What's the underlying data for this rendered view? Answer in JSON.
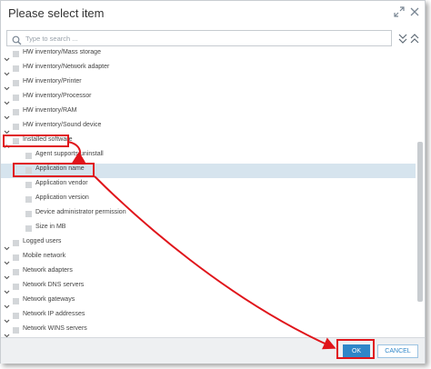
{
  "dialog": {
    "title": "Please select item",
    "expand_icon": "expand-diagonal-icon",
    "close_icon": "close-icon"
  },
  "search": {
    "placeholder": "Type to search ...",
    "value": ""
  },
  "tree": {
    "items": [
      {
        "label": "HW inventory/Mass storage",
        "expanded": false,
        "level": 0
      },
      {
        "label": "HW inventory/Network adapter",
        "expanded": false,
        "level": 0
      },
      {
        "label": "HW inventory/Printer",
        "expanded": false,
        "level": 0
      },
      {
        "label": "HW inventory/Processor",
        "expanded": false,
        "level": 0
      },
      {
        "label": "HW inventory/RAM",
        "expanded": false,
        "level": 0
      },
      {
        "label": "HW inventory/Sound device",
        "expanded": false,
        "level": 0
      },
      {
        "label": "Installed software",
        "expanded": true,
        "level": 0
      },
      {
        "label": "Agent supports uninstall",
        "level": 1
      },
      {
        "label": "Application name",
        "level": 1,
        "selected": true
      },
      {
        "label": "Application vendor",
        "level": 1
      },
      {
        "label": "Application version",
        "level": 1
      },
      {
        "label": "Device administrator permission",
        "level": 1
      },
      {
        "label": "Size in MB",
        "level": 1
      },
      {
        "label": "Logged users",
        "expanded": false,
        "level": 0
      },
      {
        "label": "Mobile network",
        "expanded": false,
        "level": 0
      },
      {
        "label": "Network adapters",
        "expanded": false,
        "level": 0
      },
      {
        "label": "Network DNS servers",
        "expanded": false,
        "level": 0
      },
      {
        "label": "Network gateways",
        "expanded": false,
        "level": 0
      },
      {
        "label": "Network IP addresses",
        "expanded": false,
        "level": 0
      },
      {
        "label": "Network WINS servers",
        "expanded": false,
        "level": 0
      }
    ]
  },
  "footer": {
    "ok_label": "OK",
    "cancel_label": "CANCEL"
  },
  "colors": {
    "accent": "#2f86c8",
    "selection": "#d6e4ee",
    "annotation": "#e0151b"
  }
}
